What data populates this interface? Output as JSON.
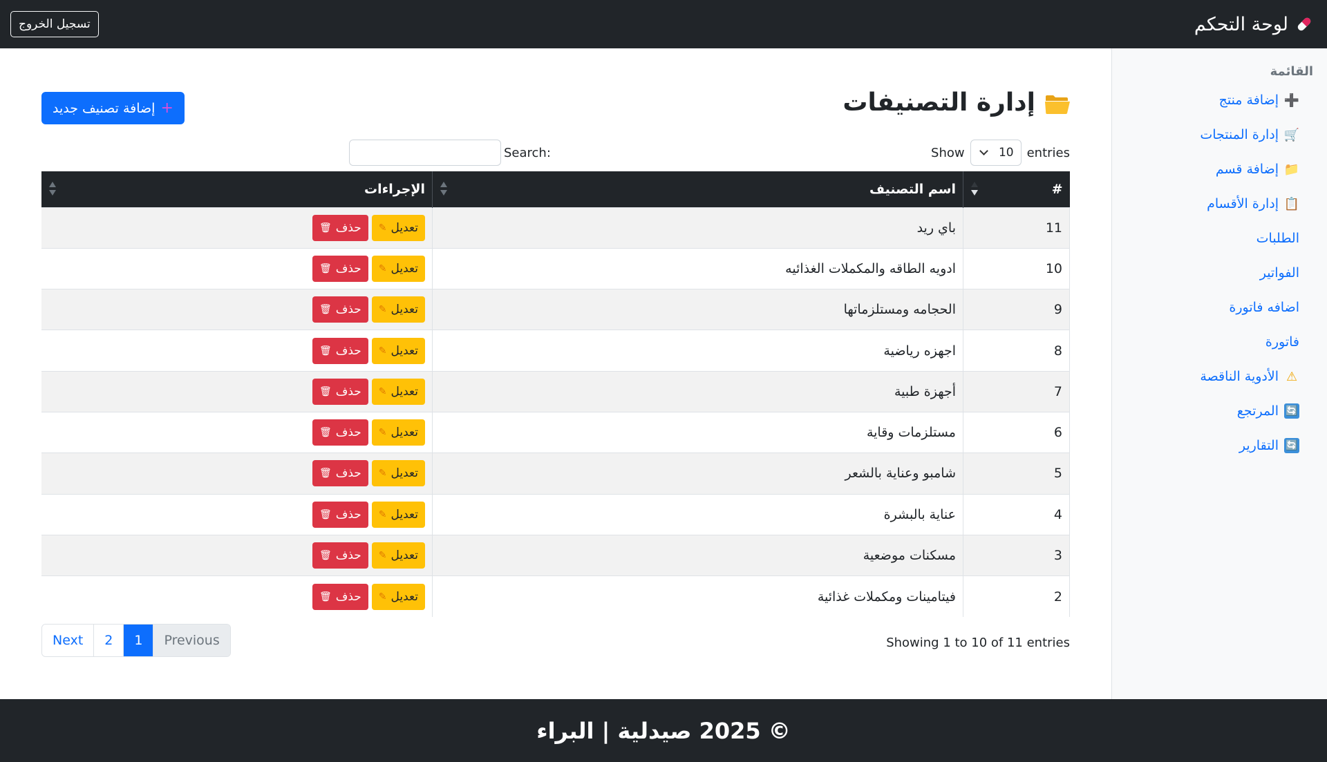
{
  "navbar": {
    "brand_icon": "pill-icon",
    "brand": "لوحة التحكم",
    "logout": "تسجيل الخروج"
  },
  "sidebar": {
    "title": "القائمة",
    "items": [
      {
        "icon": "plus-icon",
        "glyph": "➕",
        "label": "إضافة منتج"
      },
      {
        "icon": "cart-icon",
        "glyph": "🛒",
        "label": "إدارة المنتجات"
      },
      {
        "icon": "folder-icon",
        "glyph": "📁",
        "label": "إضافة قسم"
      },
      {
        "icon": "clipboard-icon",
        "glyph": "📋",
        "label": "إدارة الأقسام"
      },
      {
        "icon": "",
        "glyph": "",
        "label": "الطلبات"
      },
      {
        "icon": "",
        "glyph": "",
        "label": "الفواتير"
      },
      {
        "icon": "",
        "glyph": "",
        "label": "اضافه فاتورة"
      },
      {
        "icon": "",
        "glyph": "",
        "label": "فاتورة"
      },
      {
        "icon": "warning-icon",
        "glyph": "⚠",
        "label": "الأدوية الناقصة"
      },
      {
        "icon": "refresh-icon",
        "glyph": "🔄",
        "label": "المرتجع"
      },
      {
        "icon": "refresh-icon",
        "glyph": "🔄",
        "label": "التقارير"
      }
    ]
  },
  "main": {
    "title": "إدارة التصنيفات",
    "title_icon": "open-folder-icon",
    "add_button": "إضافة تصنيف جديد",
    "add_button_icon": "plus-icon",
    "length": {
      "show": "Show",
      "value": "10",
      "entries": "entries"
    },
    "search_label": "Search:",
    "search_value": "",
    "table": {
      "headers": [
        "#",
        "اسم التصنيف",
        "الإجراءات"
      ],
      "edit_label": "تعديل",
      "delete_label": "حذف",
      "rows": [
        {
          "id": "11",
          "name": "باي ريد"
        },
        {
          "id": "10",
          "name": "ادويه الطاقه والمكملات الغذائيه"
        },
        {
          "id": "9",
          "name": "الحجامه ومستلزماتها"
        },
        {
          "id": "8",
          "name": "اجهزه رياضية"
        },
        {
          "id": "7",
          "name": "أجهزة طبية"
        },
        {
          "id": "6",
          "name": "مستلزمات وقاية"
        },
        {
          "id": "5",
          "name": "شامبو وعناية بالشعر"
        },
        {
          "id": "4",
          "name": "عناية بالبشرة"
        },
        {
          "id": "3",
          "name": "مسكنات موضعية"
        },
        {
          "id": "2",
          "name": "فيتامينات ومكملات غذائية"
        }
      ]
    },
    "info": "Showing 1 to 10 of 11 entries",
    "pagination": [
      "Previous",
      "1",
      "2",
      "Next"
    ]
  },
  "footer": {
    "text": "© 2025 صيدلية | البراء"
  },
  "colors": {
    "dark": "#212529",
    "primary": "#0d6efd",
    "warning": "#ffc107",
    "danger": "#dc3545"
  }
}
